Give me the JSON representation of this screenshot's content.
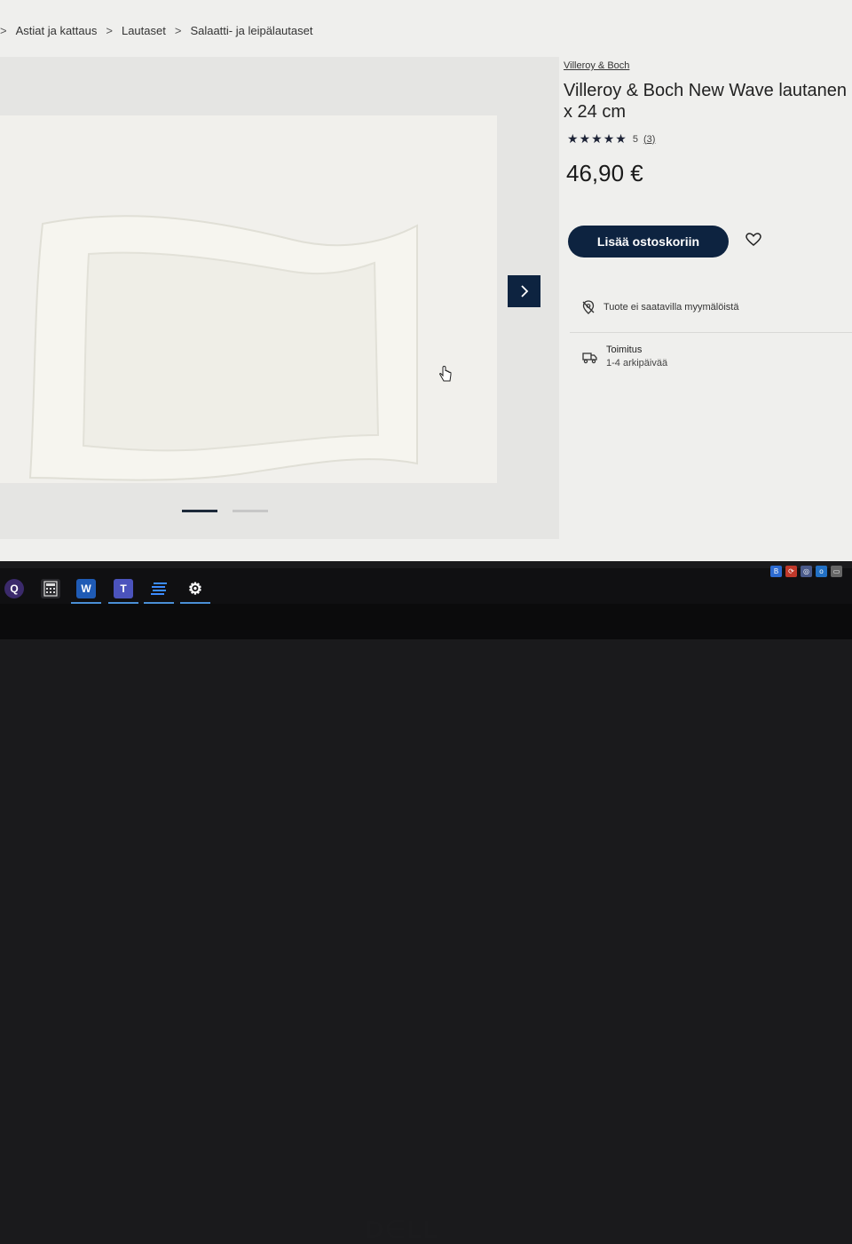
{
  "breadcrumb": {
    "items": [
      "Astiat ja kattaus",
      "Lautaset",
      "Salaatti- ja leipälautaset"
    ],
    "separator": ">"
  },
  "product": {
    "brand": "Villeroy & Boch",
    "title": "Villeroy & Boch New Wave lautanen x 24 cm",
    "rating_value": "5",
    "rating_count": "(3)",
    "stars_filled": 5,
    "price": "46,90 €",
    "add_to_cart_label": "Lisää ostoskoriin",
    "availability_text": "Tuote ei saatavilla myymälöistä",
    "delivery_title": "Toimitus",
    "delivery_time": "1-4 arkipäivää"
  },
  "gallery": {
    "slide_count": 2,
    "active_slide": 1,
    "next_icon": "chevron-right-icon"
  },
  "taskbar": {
    "apps": [
      "quest-icon",
      "calculator-icon",
      "word-icon",
      "teams-icon",
      "stream-icon",
      "settings-icon"
    ],
    "word_letter": "W",
    "teams_letter": "T",
    "quest_letter": "Q"
  },
  "colors": {
    "primary": "#0d2340",
    "background": "#efefed",
    "gallery_bg": "#e5e5e3"
  }
}
